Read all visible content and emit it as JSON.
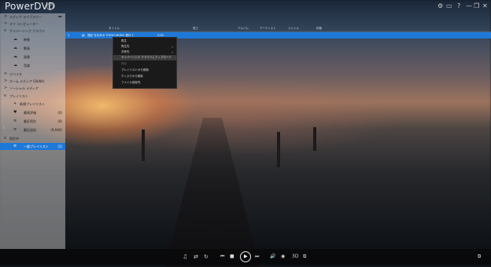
{
  "app": {
    "title": "PowerDVD"
  },
  "window_controls": [
    "⚙",
    "▭",
    "?",
    "—",
    "❐",
    "✕"
  ],
  "sidebar": {
    "items": [
      {
        "type": "section",
        "chevron": ">",
        "label": "メディア ライブラリー"
      },
      {
        "type": "section",
        "chevron": ">",
        "label": "マイ コンピューター"
      },
      {
        "type": "section",
        "chevron": "v",
        "label": "サイバーリンク クラウド"
      },
      {
        "type": "child",
        "icon": "☁",
        "label": "映像"
      },
      {
        "type": "child",
        "icon": "☁",
        "label": "動画"
      },
      {
        "type": "child",
        "icon": "☁",
        "label": "画像"
      },
      {
        "type": "child",
        "icon": "☁",
        "label": "音楽"
      },
      {
        "type": "section",
        "chevron": ">",
        "label": "デバイス"
      },
      {
        "type": "section",
        "chevron": ">",
        "label": "ホーム メディア (DLNA)"
      },
      {
        "type": "section",
        "chevron": ">",
        "label": "ソーシャル メディア"
      },
      {
        "type": "section",
        "chevron": "v",
        "label": "プレイリスト"
      },
      {
        "type": "child",
        "icon": "+",
        "label": "新規プレイリスト"
      },
      {
        "type": "child",
        "icon": "♥",
        "label": "最高評価",
        "count": "(0)"
      },
      {
        "type": "child",
        "icon": "≡",
        "label": "最近再生",
        "count": "(0)"
      },
      {
        "type": "child",
        "icon": "≡",
        "label": "最近追加",
        "count": "(9,940)"
      },
      {
        "type": "section",
        "chevron": "v",
        "label": "再生中"
      },
      {
        "type": "child",
        "icon": "≡",
        "label": "一般プレイリスト",
        "count": "(1)",
        "selected": true
      }
    ]
  },
  "list": {
    "columns": [
      "タイトル",
      "長さ",
      "アルバム",
      "アーティスト",
      "ジャンル",
      "評価"
    ],
    "rows": [
      {
        "index": "1",
        "title": "週記 ななみの TOKYO MUSIC 旅行 1",
        "length": "2:50"
      }
    ]
  },
  "context_menu": {
    "items": [
      {
        "label": "再生"
      },
      {
        "label": "再生先",
        "submenu": true
      },
      {
        "label": "共有先",
        "submenu": true
      },
      {
        "label": "サイバーリンク クラウドにアップロード",
        "highlighted": true
      },
      {
        "label": "削除",
        "disabled": true
      },
      {
        "label": "プレイリストから削除"
      },
      {
        "label": "ディスクから削除"
      },
      {
        "label": "ファイル保存先"
      }
    ]
  },
  "player": {
    "left_controls": [
      "♫",
      "⇄",
      "↻"
    ],
    "transport": [
      "⏮",
      "■",
      "⏮",
      "▶",
      "⏭"
    ],
    "right_controls": [
      "🔊",
      "◉",
      "3D",
      "⧉"
    ],
    "far_right": "⧉"
  }
}
